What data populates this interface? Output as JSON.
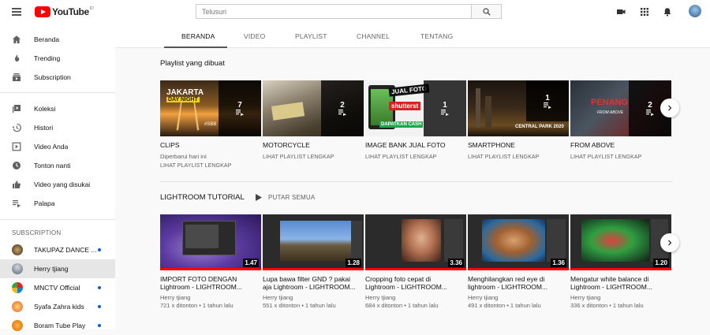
{
  "header": {
    "logo_text": "YouTube",
    "logo_region": "ID",
    "search_placeholder": "Telusuri"
  },
  "sidebar": {
    "main": [
      {
        "label": "Beranda",
        "icon": "home-icon"
      },
      {
        "label": "Trending",
        "icon": "flame-icon"
      },
      {
        "label": "Subscription",
        "icon": "subscriptions-icon"
      }
    ],
    "library": [
      {
        "label": "Koleksi",
        "icon": "library-icon"
      },
      {
        "label": "Histori",
        "icon": "history-icon"
      },
      {
        "label": "Video Anda",
        "icon": "your-videos-icon"
      },
      {
        "label": "Tonton nanti",
        "icon": "clock-icon"
      },
      {
        "label": "Video yang disukai",
        "icon": "thumbs-up-icon"
      },
      {
        "label": "Palapa",
        "icon": "playlist-icon"
      }
    ],
    "subscription_heading": "SUBSCRIPTION",
    "subscriptions": [
      {
        "label": "TAKUPAZ DANCE ...",
        "new": true
      },
      {
        "label": "Herry tjiang",
        "new": false
      },
      {
        "label": "MNCTV Official",
        "new": true
      },
      {
        "label": "Syafa Zahra kids",
        "new": true
      },
      {
        "label": "Boram Tube Play",
        "new": true
      }
    ]
  },
  "tabs": [
    "BERANDA",
    "VIDEO",
    "PLAYLIST",
    "CHANNEL",
    "TENTANG"
  ],
  "selected_tab": "BERANDA",
  "playlists_section": {
    "heading": "Playlist yang dibuat",
    "items": [
      {
        "title": "CLIPS",
        "count": "7",
        "meta": "Diperbarui hari ini",
        "link": "LIHAT PLAYLIST LENGKAP",
        "thumb_text": [
          "JAKARTA",
          "DAY NIGHT",
          "#SBB"
        ]
      },
      {
        "title": "MOTORCYCLE",
        "count": "2",
        "meta": "",
        "link": "LIHAT PLAYLIST LENGKAP",
        "thumb_text": []
      },
      {
        "title": "IMAGE BANK JUAL FOTO",
        "count": "1",
        "meta": "",
        "link": "LIHAT PLAYLIST LENGKAP",
        "thumb_text": [
          "JUAL FOTO",
          "shutterst",
          "DAPATKAN CASH"
        ]
      },
      {
        "title": "SMARTPHONE",
        "count": "1",
        "meta": "",
        "link": "LIHAT PLAYLIST LENGKAP",
        "thumb_text": [
          "CENTRAL PARK 2020"
        ]
      },
      {
        "title": "FROM ABOVE",
        "count": "2",
        "meta": "",
        "link": "LIHAT PLAYLIST LENGKAP",
        "thumb_text": [
          "PENANG",
          "FROM ABOVE"
        ]
      }
    ]
  },
  "lightroom_section": {
    "heading": "LIGHTROOM TUTORIAL",
    "play_all": "PUTAR SEMUA",
    "items": [
      {
        "title_line1": "IMPORT FOTO DENGAN",
        "title_line2": "Lightroom - LIGHTROOM...",
        "channel": "Herry tjiang",
        "stats": "721 x ditonton • 1 tahun lalu",
        "duration": "1.47",
        "progress": 1.0
      },
      {
        "title_line1": "Lupa bawa filter GND ? pakai",
        "title_line2": "aja Lightroom - LIGHTROOM...",
        "channel": "Herry tjiang",
        "stats": "551 x ditonton • 1 tahun lalu",
        "duration": "1.28",
        "progress": 1.0
      },
      {
        "title_line1": "Cropping foto cepat di",
        "title_line2": "Lightroom - LIGHTROOM...",
        "channel": "Herry tjiang",
        "stats": "684 x ditonton • 1 tahun lalu",
        "duration": "3.36",
        "progress": 1.0
      },
      {
        "title_line1": "Menghilangkan red eye di",
        "title_line2": "lightroom - LIGHTROOM...",
        "channel": "Herry tjiang",
        "stats": "491 x ditonton • 1 tahun lalu",
        "duration": "1.36",
        "progress": 1.0
      },
      {
        "title_line1": "Mengatur white balance di",
        "title_line2": "Lightroom - LIGHTROOM...",
        "channel": "Herry tjiang",
        "stats": "336 x ditonton • 1 tahun lalu",
        "duration": "1.20",
        "progress": 1.0
      }
    ]
  },
  "colors": {
    "accent": "#ff0000",
    "new_dot": "#065fd4",
    "selected_bg": "#e6e6e6"
  }
}
